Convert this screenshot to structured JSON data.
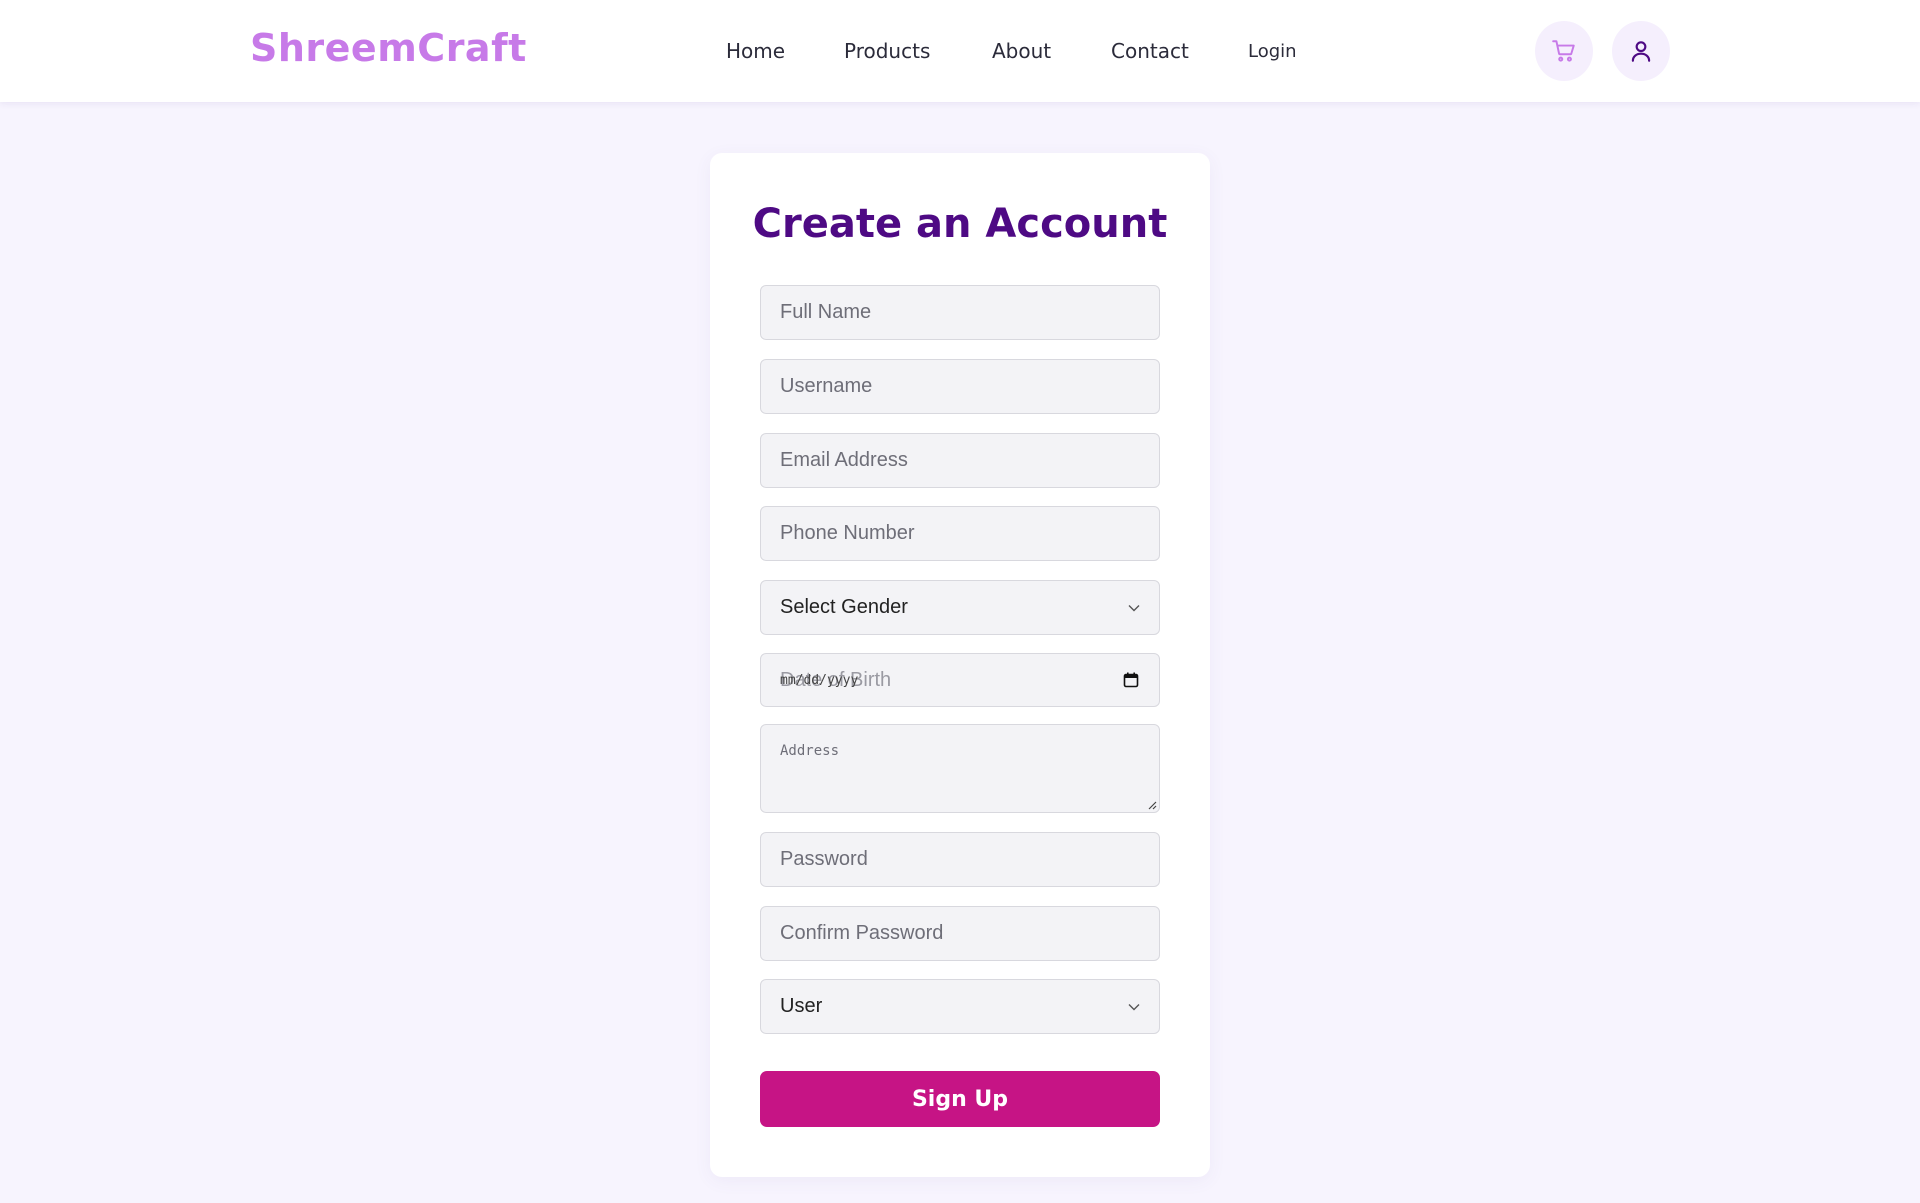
{
  "colors": {
    "brand": "#c77ae8",
    "title": "#4e0a84",
    "primary_button": "#c61485",
    "page_background": "#f7f4fe"
  },
  "nav": {
    "brand": "ShreemCraft",
    "links": [
      "Home",
      "Products",
      "About",
      "Contact",
      "Login"
    ],
    "icons": [
      "cart-icon",
      "user-icon"
    ]
  },
  "form": {
    "title": "Create an Account",
    "full_name_placeholder": "Full Name",
    "username_placeholder": "Username",
    "email_placeholder": "Email Address",
    "phone_placeholder": "Phone Number",
    "gender_selected": "Select Gender",
    "dob_placeholder": "Date of Birth",
    "dob_mask": "mm/dd/yyyy",
    "address_placeholder": "Address",
    "password_placeholder": "Password",
    "confirm_password_placeholder": "Confirm Password",
    "role_selected": "User",
    "submit_label": "Sign Up"
  }
}
